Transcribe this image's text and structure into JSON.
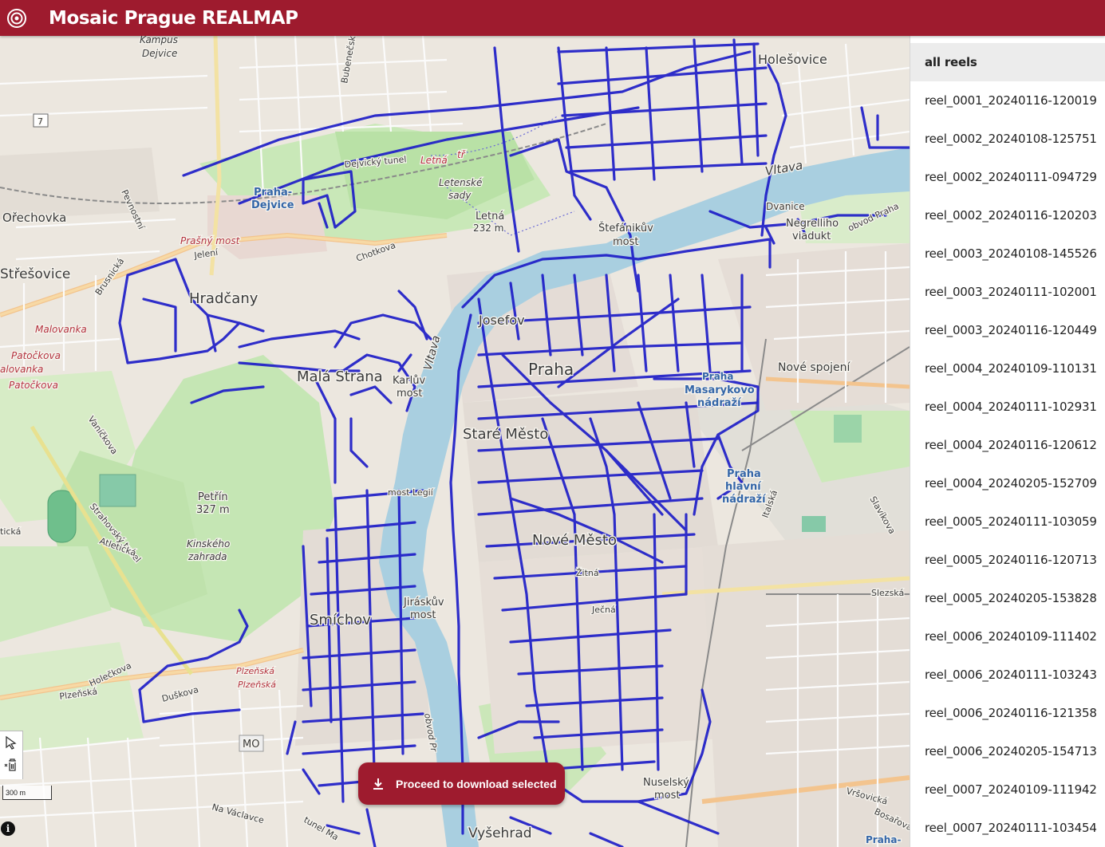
{
  "app": {
    "title": "Mosaic Prague REALMAP",
    "accent": "#9e1b2e",
    "logo_icon": "camera-lens-icon"
  },
  "map": {
    "track_color": "#1e1ec8",
    "river_color": "#a9cfe0",
    "labels": {
      "kampus_1": "Kampus",
      "kampus_2": "Dejvice",
      "bubenecska": "Bubenečská",
      "holesovice": "Holešovice",
      "route_7": "7",
      "dejvicky_tunel": "Dejvický tunel",
      "letna_street": "Letná",
      "tr": "tř",
      "praha_dejvice_1": "Praha-",
      "praha_dejvice_2": "Dejvice",
      "pevnostni": "Pevnostní",
      "letenske_1": "Letenské",
      "letenske_2": "sady",
      "letna": "Letná",
      "letna_ele": "232 m",
      "vltava_north": "Vltava",
      "orechovka": "Ořechovka",
      "prasny_most": "Prašný most",
      "jeleni": "Jelení",
      "chotkova": "Chotkova",
      "stefanikuv_1": "Štefánikův",
      "stefanikuv_2": "most",
      "negrelliho_1": "Negrelliho",
      "negrelliho_2": "viadukt",
      "dvanice": "Dvanice",
      "obvod": "obvod Praha",
      "stresovice": "Střešovice",
      "brusnicka": "Brusnická",
      "hradcany": "Hradčany",
      "malovanka": "Malovanka",
      "patockova_1": "Patočkova",
      "malovanka_2": "alovanka",
      "patockova_2": "Patočkova",
      "mala_strana": "Malá Strana",
      "karluv_1": "Karlův",
      "karluv_2": "most",
      "vltava_mid": "Vltava",
      "stare_mesto": "Staré Město",
      "josefov": "Josefov",
      "praha": "Praha",
      "prasna": "Praha",
      "masarykovo_1": "Masarykovo",
      "masarykovo_2": "nádraží",
      "nove_spojeni": "Nové spojení",
      "vanickova": "Vaníčkova",
      "petrin_1": "Petřín",
      "petrin_2": "327 m",
      "most_legii": "most Legií",
      "strahovsky": "Strahovský tunel",
      "atleticka": "Atletická",
      "kinskeho_1": "Kinského",
      "kinskeho_2": "zahrada",
      "ticka": "tická",
      "praha_hlavni_1": "Praha",
      "praha_hlavni_2": "hlavní",
      "praha_hlavni_3": "nádraží",
      "italska": "Italská",
      "slavikova": "Slavíkova",
      "nove_mesto": "Nové Město",
      "zitna": "Žitná",
      "jecna": "Ječná",
      "slezska": "Slezská",
      "jiraskuv_1": "Jiráskův",
      "jiraskuv_2": "most",
      "smichov": "Smíchov",
      "holeckova": "Holečkova",
      "plzenska_1": "Plzeňská",
      "plzenska_2": "Plzeňská",
      "plzenska_3": "Plzeňská",
      "duskova": "Duškova",
      "mo": "MO",
      "obvod_praha_2": "obvod Pr",
      "na_vaclavce": "Na Václavce",
      "tunel": "tunel Ma",
      "nuselsky_1": "Nuselský",
      "nuselsky_2": "most",
      "vysehrad": "Vyšehrad",
      "vrsovicka": "Vršovická",
      "bozdechova": "Bosařova",
      "praha_se": "Praha-"
    },
    "scale_label": "300 m",
    "info_label": "i"
  },
  "tools": {
    "select_icon": "lasso-select-icon",
    "delete_icon": "trash-select-icon"
  },
  "download_button": {
    "label": "Proceed to download selected",
    "icon": "download-icon"
  },
  "sidebar": {
    "reels": [
      "all reels",
      "reel_0001_20240116-120019",
      "reel_0002_20240108-125751",
      "reel_0002_20240111-094729",
      "reel_0002_20240116-120203",
      "reel_0003_20240108-145526",
      "reel_0003_20240111-102001",
      "reel_0003_20240116-120449",
      "reel_0004_20240109-110131",
      "reel_0004_20240111-102931",
      "reel_0004_20240116-120612",
      "reel_0004_20240205-152709",
      "reel_0005_20240111-103059",
      "reel_0005_20240116-120713",
      "reel_0005_20240205-153828",
      "reel_0006_20240109-111402",
      "reel_0006_20240111-103243",
      "reel_0006_20240116-121358",
      "reel_0006_20240205-154713",
      "reel_0007_20240109-111942",
      "reel_0007_20240111-103454"
    ]
  }
}
